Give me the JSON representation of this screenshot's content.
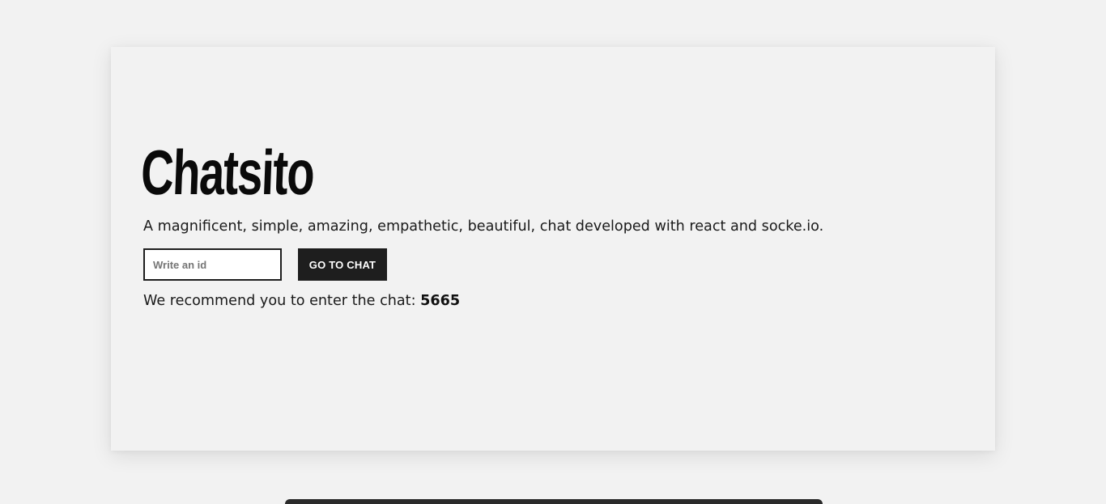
{
  "app": {
    "title": "Chatsito",
    "tagline": "A magnificent, simple, amazing, empathetic, beautiful, chat developed with react and socke.io."
  },
  "join_form": {
    "input_value": "",
    "input_placeholder": "Write an id",
    "button_label": "GO TO CHAT"
  },
  "recommendation": {
    "prefix": "We recommend you to enter the chat:",
    "chat_id": "5665"
  },
  "colors": {
    "background": "#f2f2f2",
    "button": "#1e1e1e",
    "button_text": "#ffffff",
    "text": "#1a1a1a"
  }
}
